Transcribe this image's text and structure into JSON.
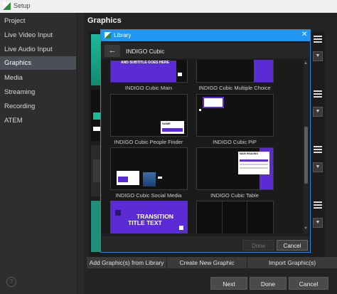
{
  "window": {
    "title": "Setup"
  },
  "sidebar": {
    "items": [
      {
        "label": "Project"
      },
      {
        "label": "Live Video Input"
      },
      {
        "label": "Live Audio Input"
      },
      {
        "label": "Graphics",
        "active": true
      },
      {
        "label": "Media"
      },
      {
        "label": "Streaming"
      },
      {
        "label": "Recording"
      },
      {
        "label": "ATEM"
      }
    ],
    "help_icon": "?"
  },
  "main": {
    "title": "Graphics",
    "toolbar": {
      "add_from_library": "Add Graphic(s) from Library",
      "create_new": "Create New Graphic",
      "import": "Import Graphic(s)"
    }
  },
  "footer": {
    "next": "Next",
    "done": "Done",
    "cancel": "Cancel"
  },
  "library": {
    "title": "Library",
    "close": "✕",
    "back": "←",
    "path": "INDIGO Cubic",
    "items": [
      {
        "label": "INDIGO Cubic Main",
        "text": "AND SUBTITLE GOES HERE"
      },
      {
        "label": "INDIGO Cubic Multiple Choice"
      },
      {
        "label": "INDIGO Cubic People Finder",
        "text": "NAME"
      },
      {
        "label": "INDIGO Cubic PiP"
      },
      {
        "label": "INDIGO Cubic Social Media"
      },
      {
        "label": "INDIGO Cubic Table",
        "text": "MAIN HEADING"
      },
      {
        "label": "",
        "text_line1": "TRANSITION",
        "text_line2": "TITLE TEXT"
      },
      {
        "label": ""
      }
    ],
    "done": "Done",
    "cancel": "Cancel"
  },
  "colors": {
    "accent": "#2196f3",
    "indigo": "#5b2bd6",
    "active_item": "#4a4f58"
  }
}
